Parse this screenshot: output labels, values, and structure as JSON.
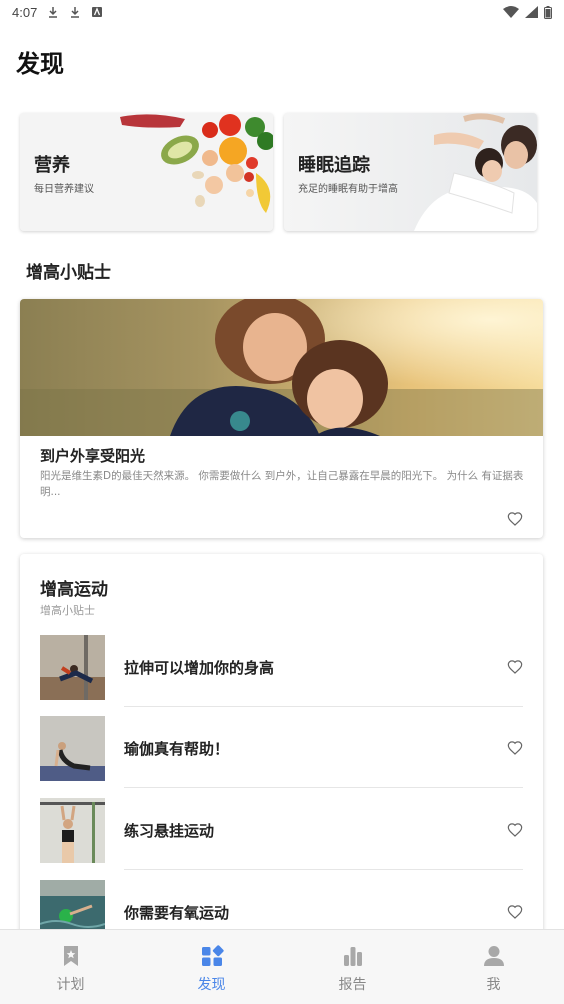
{
  "status_bar": {
    "time": "4:07"
  },
  "page_title": "发现",
  "cards": {
    "nutrition": {
      "title": "营养",
      "subtitle": "每日营养建议"
    },
    "sleep": {
      "title": "睡眠追踪",
      "subtitle": "充足的睡眠有助于增高"
    }
  },
  "tips_section": {
    "title": "增高小贴士",
    "article": {
      "title": "到户外享受阳光",
      "description": "阳光是维生素D的最佳天然来源。 你需要做什么 到户外，让自己暴露在早晨的阳光下。 为什么 有证据表明..."
    }
  },
  "exercise_section": {
    "title": "增高运动",
    "subtitle": "增高小贴士",
    "items": [
      {
        "label": "拉伸可以增加你的身高"
      },
      {
        "label": "瑜伽真有帮助！"
      },
      {
        "label": "练习悬挂运动"
      },
      {
        "label": "你需要有氧运动"
      }
    ]
  },
  "bottom_nav": {
    "items": [
      {
        "label": "计划",
        "icon": "bookmark-star-icon"
      },
      {
        "label": "发现",
        "icon": "grid-discover-icon"
      },
      {
        "label": "报告",
        "icon": "bar-chart-icon"
      },
      {
        "label": "我",
        "icon": "person-icon"
      }
    ],
    "active_index": 1
  },
  "colors": {
    "accent": "#4a86e8",
    "inactive": "#888888"
  }
}
